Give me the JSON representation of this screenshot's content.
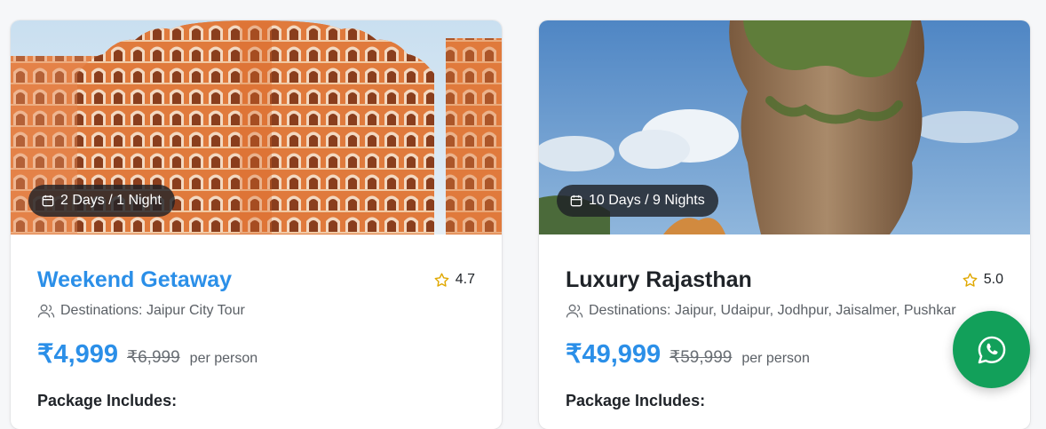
{
  "packages": [
    {
      "duration": "2 Days / 1 Night",
      "title": "Weekend Getaway",
      "rating": "4.7",
      "destinations": "Destinations: Jaipur City Tour",
      "price": "₹4,999",
      "old_price": "₹6,999",
      "per": "per person",
      "includes_heading": "Package Includes:"
    },
    {
      "duration": "10 Days / 9 Nights",
      "title": "Luxury Rajasthan",
      "rating": "5.0",
      "destinations": "Destinations: Jaipur, Udaipur, Jodhpur, Jaisalmer, Pushkar",
      "price": "₹49,999",
      "old_price": "₹59,999",
      "per": "per person",
      "includes_heading": "Package Includes:"
    }
  ],
  "colors": {
    "accent": "#2b8fe8",
    "whatsapp": "#12a05a",
    "star": "#e0a800"
  },
  "icons": {
    "duration": "calendar-icon",
    "rating": "star-icon",
    "destinations": "users-icon",
    "floating": "whatsapp-icon"
  }
}
